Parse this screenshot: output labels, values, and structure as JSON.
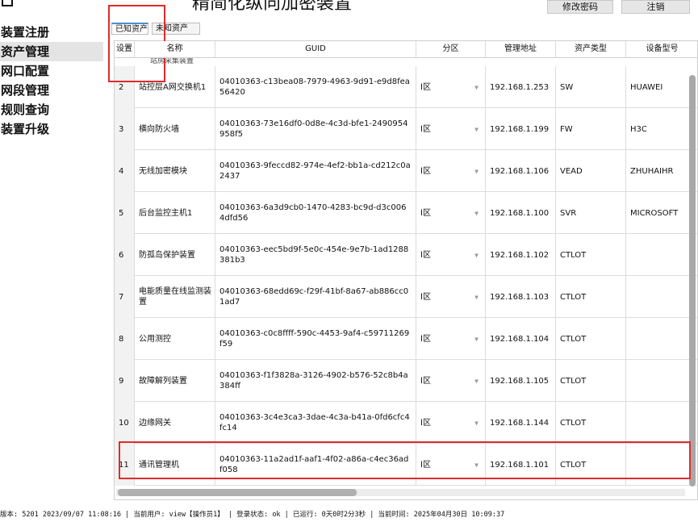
{
  "header": {
    "title": "精简化纵向加密装置",
    "change_password": "修改密码",
    "logout": "注销"
  },
  "sidebar": {
    "items": [
      {
        "label": "装置注册"
      },
      {
        "label": "资产管理"
      },
      {
        "label": "网口配置"
      },
      {
        "label": "网段管理"
      },
      {
        "label": "规则查询"
      },
      {
        "label": "装置升级"
      }
    ]
  },
  "tabs": {
    "known": "已知资产",
    "unknown": "未知资产"
  },
  "table": {
    "headers": {
      "setting": "设置",
      "name": "名称",
      "guid": "GUID",
      "zone": "分区",
      "address": "管理地址",
      "asset_type": "资产类型",
      "model": "设备型号"
    },
    "partial_row_name": "站房采集装置",
    "rows": [
      {
        "num": "2",
        "name": "站控层A网交换机1",
        "guid": "04010363-c13bea08-7979-4963-9d91-e9d8fea56420",
        "zone": "Ⅰ区",
        "address": "192.168.1.253",
        "type": "SW",
        "model": "HUAWEI"
      },
      {
        "num": "3",
        "name": "横向防火墙",
        "guid": "04010363-73e16df0-0d8e-4c3d-bfe1-2490954958f5",
        "zone": "Ⅰ区",
        "address": "192.168.1.199",
        "type": "FW",
        "model": "H3C"
      },
      {
        "num": "4",
        "name": "无线加密模块",
        "guid": "04010363-9feccd82-974e-4ef2-bb1a-cd212c0a2437",
        "zone": "Ⅰ区",
        "address": "192.168.1.106",
        "type": "VEAD",
        "model": "ZHUHAIHR"
      },
      {
        "num": "5",
        "name": "后台监控主机1",
        "guid": "04010363-6a3d9cb0-1470-4283-bc9d-d3c0064dfd56",
        "zone": "Ⅰ区",
        "address": "192.168.1.100",
        "type": "SVR",
        "model": "MICROSOFT"
      },
      {
        "num": "6",
        "name": "防孤岛保护装置",
        "guid": "04010363-eec5bd9f-5e0c-454e-9e7b-1ad1288381b3",
        "zone": "Ⅰ区",
        "address": "192.168.1.102",
        "type": "CTLOT",
        "model": ""
      },
      {
        "num": "7",
        "name": "电能质量在线监测装置",
        "guid": "04010363-68edd69c-f29f-41bf-8a67-ab886cc01ad7",
        "zone": "Ⅰ区",
        "address": "192.168.1.103",
        "type": "CTLOT",
        "model": ""
      },
      {
        "num": "8",
        "name": "公用测控",
        "guid": "04010363-c0c8ffff-590c-4453-9af4-c59711269f59",
        "zone": "Ⅰ区",
        "address": "192.168.1.104",
        "type": "CTLOT",
        "model": ""
      },
      {
        "num": "9",
        "name": "故障解列装置",
        "guid": "04010363-f1f3828a-3126-4902-b576-52c8b4a384ff",
        "zone": "Ⅰ区",
        "address": "192.168.1.105",
        "type": "CTLOT",
        "model": ""
      },
      {
        "num": "10",
        "name": "边缘网关",
        "guid": "04010363-3c4e3ca3-3dae-4c3a-b41a-0fd6cfc4fc14",
        "zone": "Ⅰ区",
        "address": "192.168.1.144",
        "type": "CTLOT",
        "model": ""
      },
      {
        "num": "11",
        "name": "通讯管理机",
        "guid": "04010363-11a2ad1f-aaf1-4f02-a86a-c4ec36adf058",
        "zone": "Ⅰ区",
        "address": "192.168.1.101",
        "type": "CTLOT",
        "model": ""
      }
    ]
  },
  "status_bar": "版本: 5201 2023/09/07 11:08:16 | 当前用户: view【操作员1】 | 登录状态: ok | 已运行: 0天0时2分3秒 | 当前时间: 2025年04月30日 10:09:37",
  "colors": {
    "highlight": "#e02b2b",
    "tab_accent": "#4a8fd0",
    "active_sidebar": "#e4e4e4"
  }
}
